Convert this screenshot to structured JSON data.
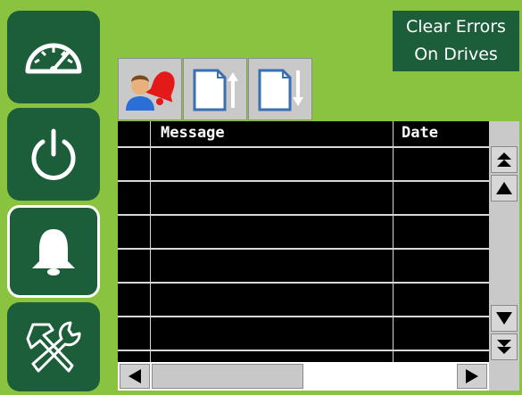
{
  "nav": {
    "items": [
      {
        "name": "dashboard",
        "icon": "speedometer-icon"
      },
      {
        "name": "power",
        "icon": "power-icon"
      },
      {
        "name": "alarms",
        "icon": "bell-icon",
        "active": true
      },
      {
        "name": "tools",
        "icon": "hammer-wrench-icon"
      }
    ]
  },
  "clear_button": {
    "line1": "Clear Errors",
    "line2": "On Drives"
  },
  "toolbar": {
    "buttons": [
      {
        "name": "acknowledge-alarm",
        "icon": "user-bell-icon"
      },
      {
        "name": "export",
        "icon": "document-up-icon"
      },
      {
        "name": "import",
        "icon": "document-down-icon"
      }
    ]
  },
  "table": {
    "columns": [
      "",
      "Message",
      "Date"
    ],
    "rows": [
      [
        "",
        "",
        ""
      ],
      [
        "",
        "",
        ""
      ],
      [
        "",
        "",
        ""
      ],
      [
        "",
        "",
        ""
      ],
      [
        "",
        "",
        ""
      ],
      [
        "",
        "",
        ""
      ]
    ]
  },
  "colors": {
    "background": "#8ac33f",
    "nav": "#1c5e3a",
    "grid": "#000000",
    "gridline": "#d8d8d8"
  }
}
